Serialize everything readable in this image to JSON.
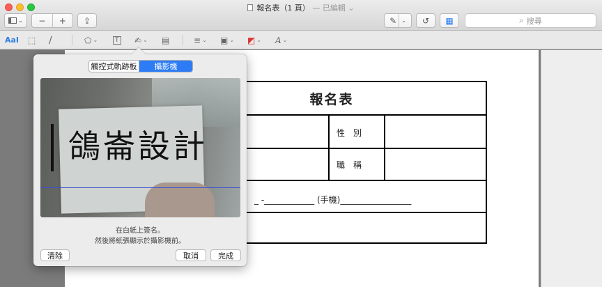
{
  "window": {
    "title": "報名表（1 頁）",
    "edited": "— 已編輯",
    "edited_caret": "⌄"
  },
  "toolbar": {
    "sidebar_icon": "sidebar-icon",
    "zoom_out": "−",
    "zoom_in": "+",
    "share": "⇪",
    "pen_glyph": "✎",
    "rotate_glyph": "↺",
    "toolbox_glyph": "▦",
    "caret": "⌄",
    "search_glyph": "⌕",
    "search_placeholder": "搜尋"
  },
  "markup": {
    "text_style": "AaI",
    "select_glyph": "⬚",
    "sketch_glyph": "∕",
    "shapes_glyph": "⬠",
    "textbox_glyph": "T",
    "sign_glyph": "✍",
    "note_glyph": "▤",
    "lines_glyph": "≡",
    "border_glyph": "▣",
    "fill_glyph": "◩",
    "font_glyph": "A",
    "caret": "⌄"
  },
  "document": {
    "form_title": "報名表",
    "label_gender": "性別",
    "label_title": "職稱",
    "phone_line": "_ -____________ (手機)_________________"
  },
  "signature_popover": {
    "tabs": [
      "觸控式軌跡板",
      "攝影機"
    ],
    "active_tab": "攝影機",
    "camera_signature": "鴿崙設計",
    "hint_line1": "在白紙上簽名。",
    "hint_line2": "然後將紙張顯示於攝影機前。",
    "clear_button": "清除",
    "cancel_button": "取消",
    "done_button": "完成"
  },
  "colors": {
    "accent": "#2d7cf5",
    "close": "#fc5f57",
    "minimize": "#fdbc2e",
    "maximize": "#29c840",
    "signature_line": "#3b4fd6"
  }
}
